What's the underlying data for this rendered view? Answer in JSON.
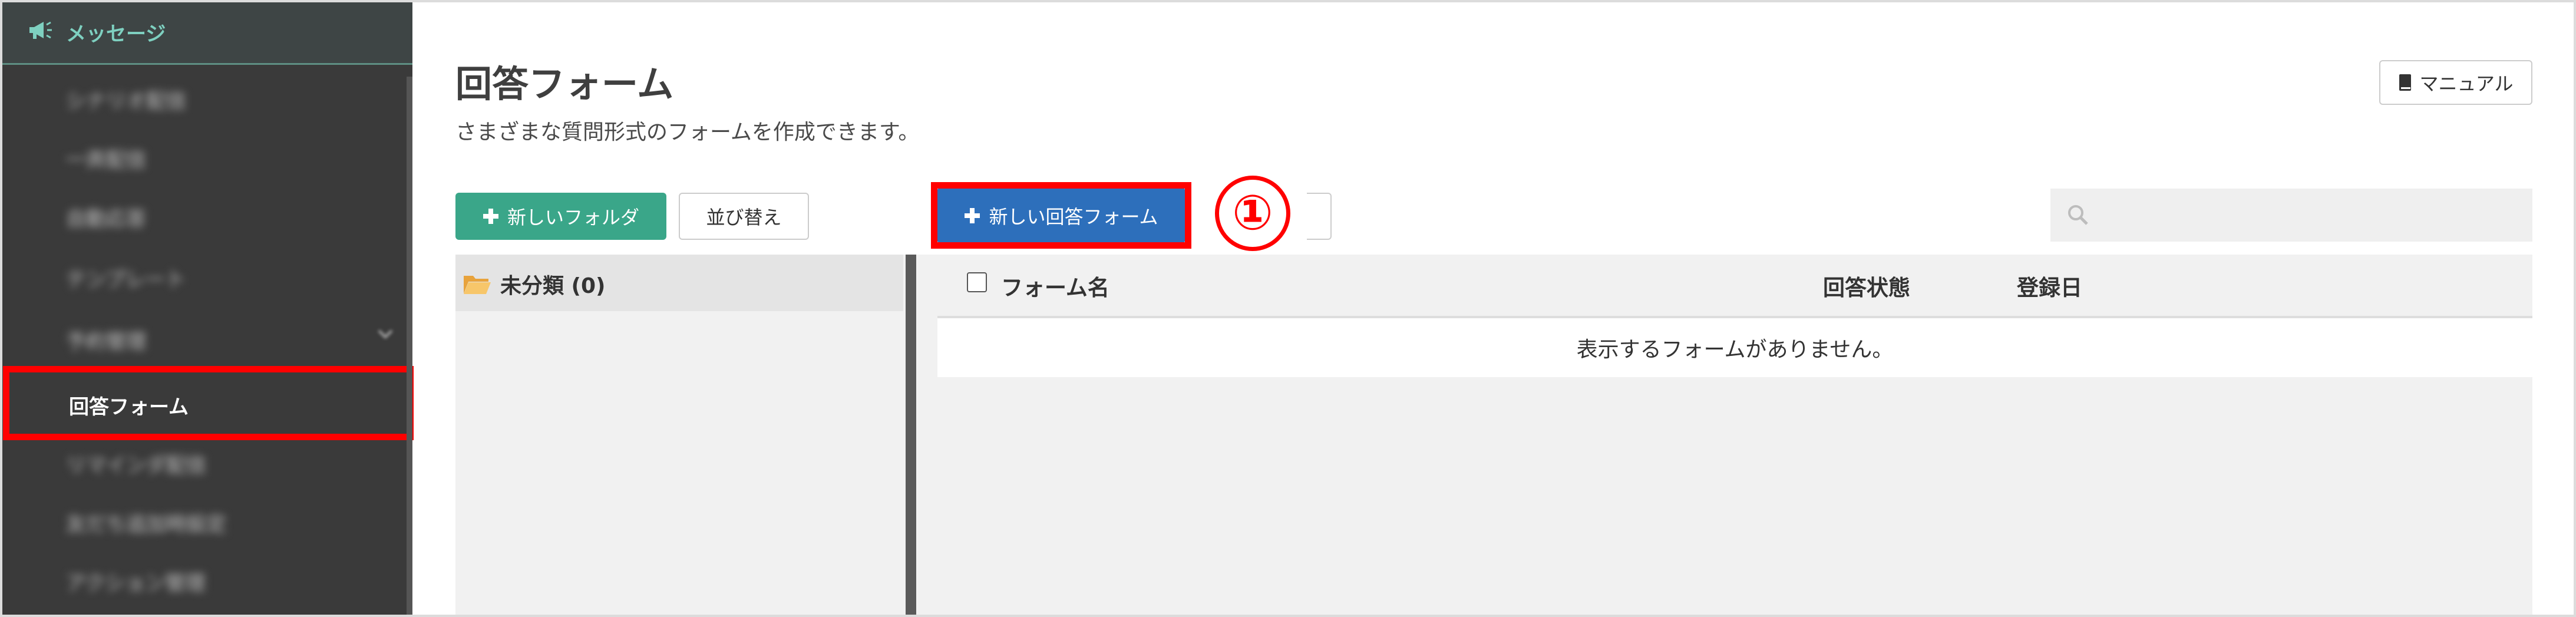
{
  "sidebar": {
    "header_label": "メッセージ",
    "items": [
      {
        "label": "シナリオ配信"
      },
      {
        "label": "一斉配信"
      },
      {
        "label": "自動応答"
      },
      {
        "label": "テンプレート"
      },
      {
        "label": "予約管理"
      },
      {
        "label": "回答フォーム"
      },
      {
        "label": "リマインダ配信"
      },
      {
        "label": "友だち追加時設定"
      },
      {
        "label": "アクション管理"
      }
    ]
  },
  "header": {
    "title": "回答フォーム",
    "subtitle": "さまざまな質問形式のフォームを作成できます。",
    "manual_label": "マニュアル"
  },
  "toolbar": {
    "new_folder_label": "新しいフォルダ",
    "sort_label": "並び替え",
    "new_form_label": "新しい回答フォーム",
    "callout_number": "①",
    "search_placeholder": ""
  },
  "folders": [
    {
      "label": "未分類 (0)"
    }
  ],
  "table": {
    "columns": {
      "name": "フォーム名",
      "status": "回答状態",
      "date": "登録日"
    },
    "empty_message": "表示するフォームがありません。"
  },
  "colors": {
    "sidebar_bg": "#3a3a3a",
    "accent_green": "#3aa689",
    "primary_blue": "#2d6fbb",
    "highlight_red": "#ff0000",
    "header_teal": "#7ed0c0"
  }
}
